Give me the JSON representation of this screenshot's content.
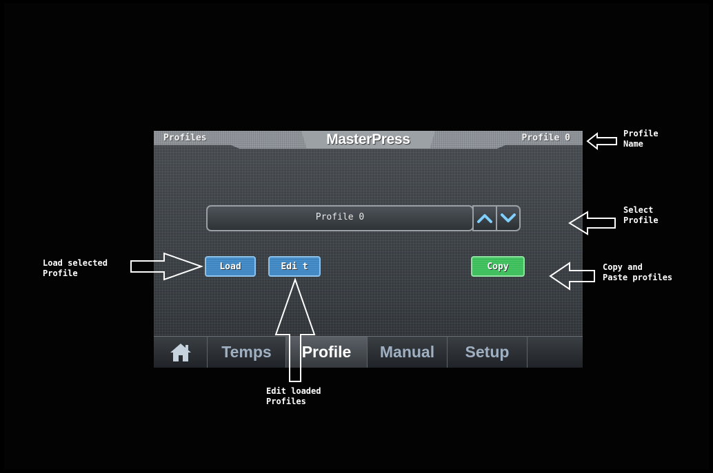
{
  "screen": {
    "header": {
      "left": "Profiles",
      "title": "MasterPress",
      "right": "Profile 0"
    },
    "selector": {
      "value": "Profile 0",
      "up_icon": "chevron-up-icon",
      "down_icon": "chevron-down-icon"
    },
    "buttons": {
      "load": "Load",
      "edit": "Edi t",
      "copy": "Copy"
    },
    "nav": {
      "home_icon": "home-icon",
      "temps": "Temps",
      "profile": "Profile",
      "manual": "Manual",
      "setup": "Setup"
    }
  },
  "annotations": {
    "profile_name": "Profile\nName",
    "select_profile": "Select\nProfile",
    "load_selected": "Load selected\nProfile",
    "copy_paste": "Copy and\nPaste profiles",
    "edit_loaded": "Edit loaded\nProfiles"
  },
  "colors": {
    "load_edit_button": "#3d86c2",
    "copy_button": "#3bbd5a",
    "background": "#000000"
  }
}
